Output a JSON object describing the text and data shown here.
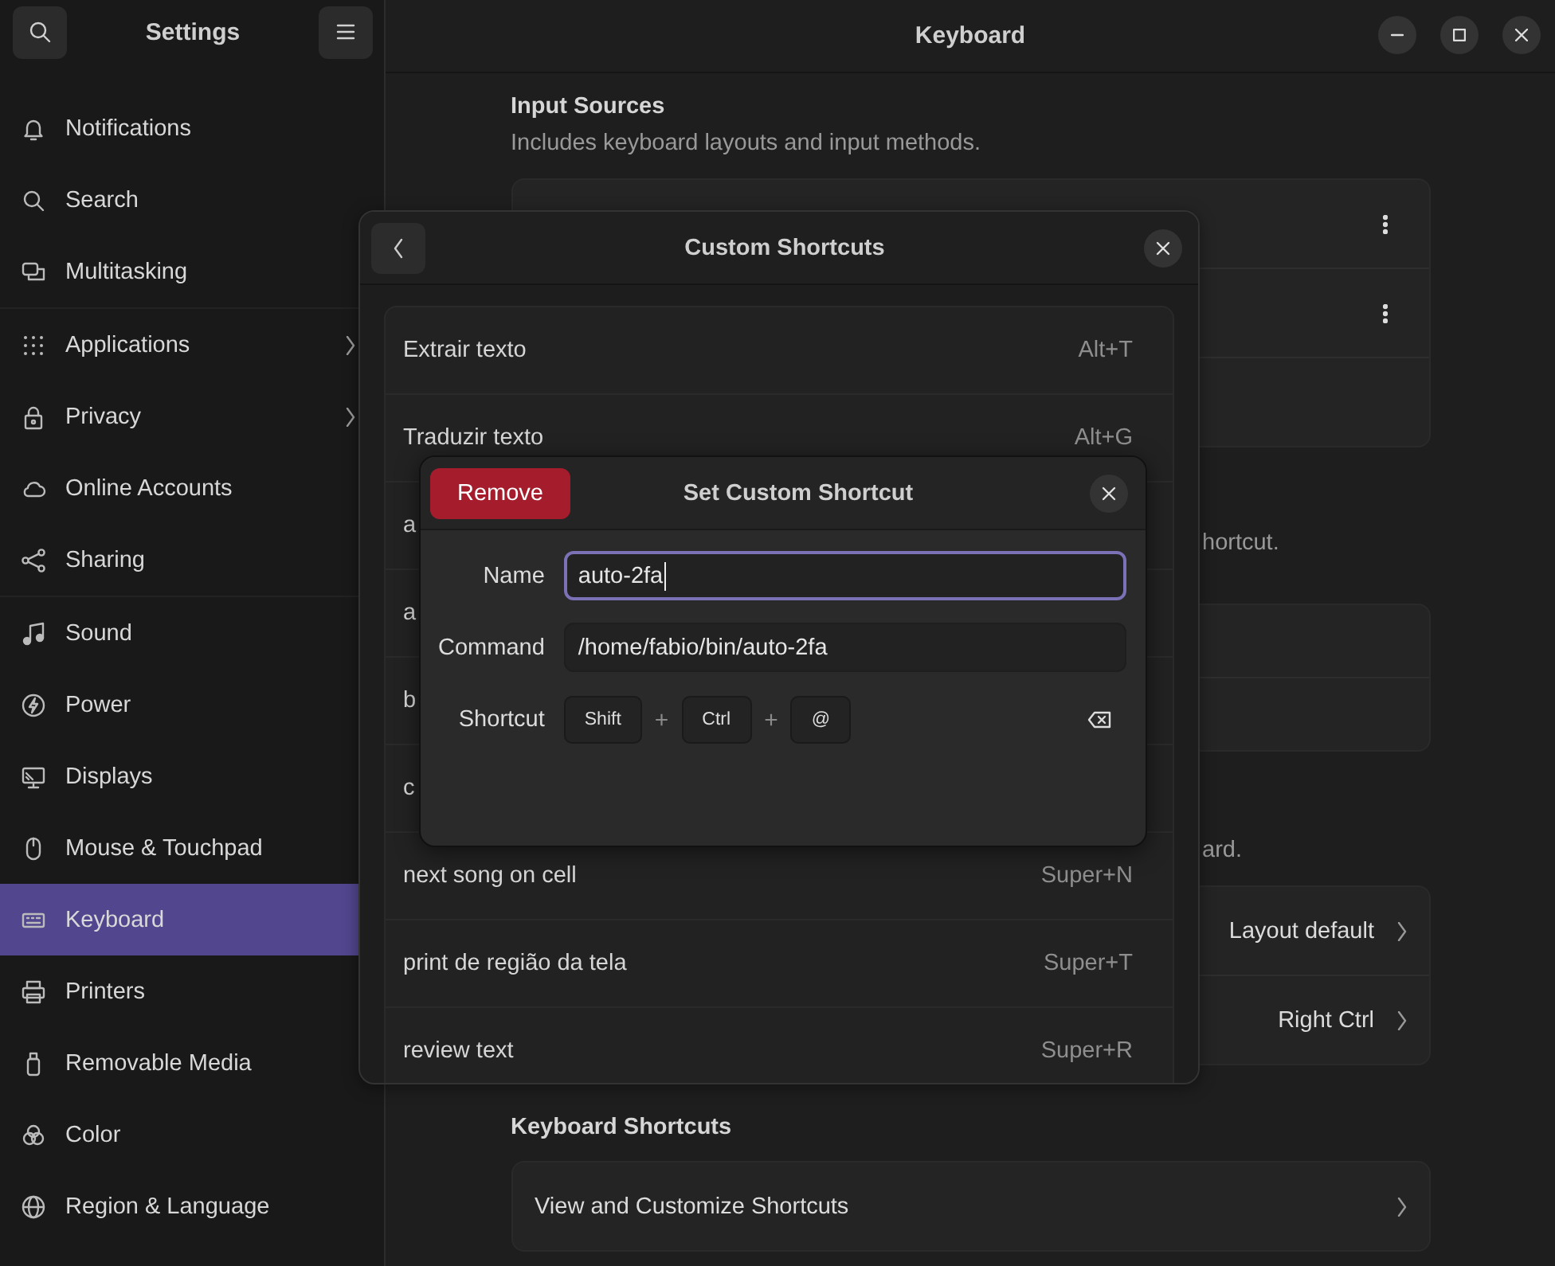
{
  "window": {
    "sidebar_title": "Settings",
    "title": "Keyboard"
  },
  "sidebar": {
    "items": [
      {
        "label": "Notifications",
        "selected": false,
        "submenu": false
      },
      {
        "label": "Search",
        "selected": false,
        "submenu": false
      },
      {
        "label": "Multitasking",
        "selected": false,
        "submenu": false
      },
      {
        "label": "Applications",
        "selected": false,
        "submenu": true
      },
      {
        "label": "Privacy",
        "selected": false,
        "submenu": true
      },
      {
        "label": "Online Accounts",
        "selected": false,
        "submenu": false
      },
      {
        "label": "Sharing",
        "selected": false,
        "submenu": false
      },
      {
        "label": "Sound",
        "selected": false,
        "submenu": false
      },
      {
        "label": "Power",
        "selected": false,
        "submenu": false
      },
      {
        "label": "Displays",
        "selected": false,
        "submenu": false
      },
      {
        "label": "Mouse & Touchpad",
        "selected": false,
        "submenu": false
      },
      {
        "label": "Keyboard",
        "selected": true,
        "submenu": false
      },
      {
        "label": "Printers",
        "selected": false,
        "submenu": false
      },
      {
        "label": "Removable Media",
        "selected": false,
        "submenu": false
      },
      {
        "label": "Color",
        "selected": false,
        "submenu": false
      },
      {
        "label": "Region & Language",
        "selected": false,
        "submenu": false
      }
    ]
  },
  "sections": [
    {
      "heading": "Input Sources",
      "description": "Includes keyboard layouts and input methods.",
      "rows": [
        {
          "kind": "menu"
        },
        {
          "kind": "menu"
        },
        {
          "kind": "blank"
        }
      ]
    },
    {
      "description": "hortcut.",
      "rows": [
        {
          "kind": "blank"
        },
        {
          "kind": "blank"
        }
      ]
    },
    {
      "description": "ard.",
      "rows": [
        {
          "kind": "link",
          "value": "Layout default"
        },
        {
          "kind": "link",
          "value": "Right Ctrl"
        }
      ]
    },
    {
      "heading": "Keyboard Shortcuts",
      "rows": [
        {
          "kind": "link",
          "label": "View and Customize Shortcuts"
        }
      ]
    }
  ],
  "custom_shortcuts": {
    "title": "Custom Shortcuts",
    "shortcuts": [
      {
        "name": "Extrair texto",
        "accel": "Alt+T"
      },
      {
        "name": "Traduzir texto",
        "accel": "Alt+G"
      },
      {
        "name": "a"
      },
      {
        "name": "a"
      },
      {
        "name": "b"
      },
      {
        "name": "c"
      },
      {
        "name": "next song on cell",
        "accel": "Super+N"
      },
      {
        "name": "print de região da tela",
        "accel": "Super+T"
      },
      {
        "name": "review text",
        "accel": "Super+R"
      }
    ]
  },
  "set_shortcut": {
    "title": "Set Custom Shortcut",
    "remove_button": "Remove",
    "fields": [
      {
        "label": "Name",
        "value": "auto-2fa",
        "focused": true
      },
      {
        "label": "Command",
        "value": "/home/fabio/bin/auto-2fa",
        "focused": false
      }
    ],
    "shortcut_label": "Shortcut",
    "keys": [
      "Shift",
      "Ctrl",
      "@"
    ],
    "separators": [
      "+",
      "+"
    ]
  }
}
